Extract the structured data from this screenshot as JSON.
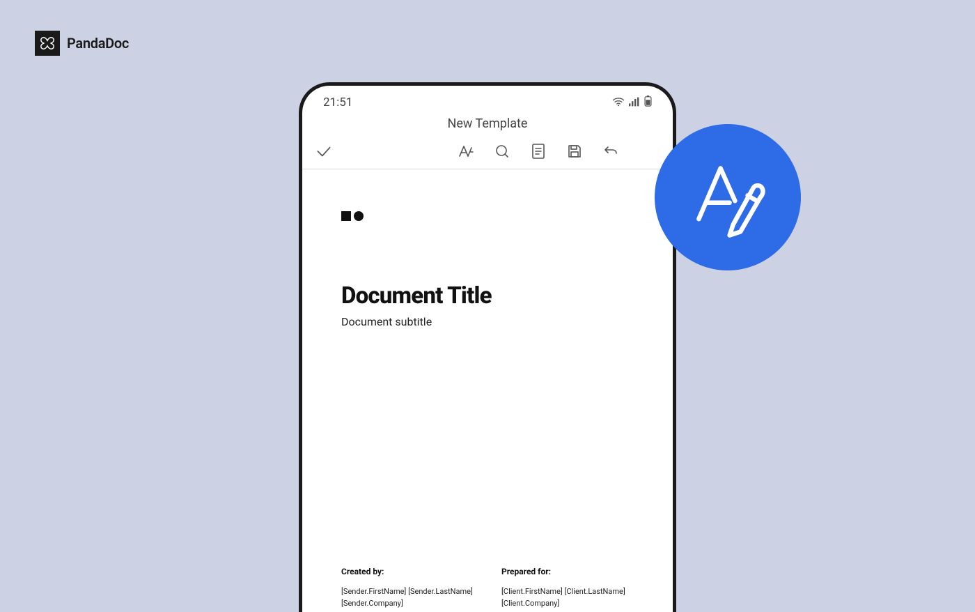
{
  "brand": {
    "name": "PandaDoc"
  },
  "statusBar": {
    "time": "21:51"
  },
  "screen": {
    "title": "New Template"
  },
  "document": {
    "title": "Document Title",
    "subtitle": "Document subtitle",
    "createdBy": {
      "label": "Created by:",
      "line1": "[Sender.FirstName] [Sender.LastName]",
      "line2": "[Sender.Company]"
    },
    "preparedFor": {
      "label": "Prepared for:",
      "line1": "[Client.FirstName] [Client.LastName]",
      "line2": "[Client.Company]"
    }
  }
}
